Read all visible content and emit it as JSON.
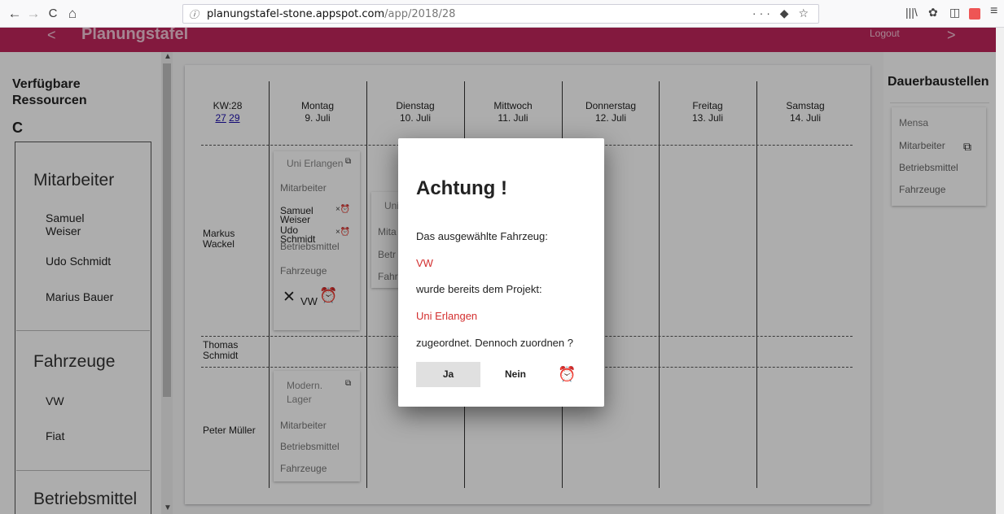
{
  "browser": {
    "back": "←",
    "forward": "→",
    "reload": "C",
    "home": "⌂",
    "info_icon": "ⓘ",
    "url_host": "planungstafel-stone.appspot.com",
    "url_path": "/app/2018/28",
    "url_actions": "··· ◆ ☆",
    "library_icon": "|||\\",
    "menu_icon": "≡"
  },
  "header": {
    "title": "Planungstafel",
    "logout": "Logout",
    "back": "<",
    "forward": ">"
  },
  "left_sidebar": {
    "title": "Verfügbare Ressourcen",
    "refresh": "C",
    "sections": {
      "mitarbeiter": {
        "title": "Mitarbeiter",
        "items": [
          "Samuel Weiser",
          "Udo Schmidt",
          "Marius Bauer"
        ]
      },
      "fahrzeuge": {
        "title": "Fahrzeuge",
        "items": [
          "VW",
          "Fiat"
        ]
      },
      "betriebsmittel": {
        "title": "Betriebsmittel"
      }
    }
  },
  "board": {
    "kw": {
      "label": "KW:28",
      "prev": "27",
      "next": "29"
    },
    "days": [
      {
        "name": "Montag",
        "date": "9. Juli"
      },
      {
        "name": "Dienstag",
        "date": "10. Juli"
      },
      {
        "name": "Mittwoch",
        "date": "11. Juli"
      },
      {
        "name": "Donnerstag",
        "date": "12. Juli"
      },
      {
        "name": "Freitag",
        "date": "13. Juli"
      },
      {
        "name": "Samstag",
        "date": "14. Juli"
      }
    ],
    "rows": [
      "Markus Wackel",
      "Thomas Schmidt",
      "Peter Müller"
    ],
    "card1": {
      "project": "Uni Erlangen",
      "mitarbeiter": "Mitarbeiter",
      "persons": [
        "Samuel Weiser",
        "Udo Schmidt"
      ],
      "person_actions": "×⏰",
      "betriebsmittel": "Betriebsmittel",
      "fahrzeuge": "Fahrzeuge",
      "vehicle": "VW",
      "remove": "✕",
      "alarm": "⏰"
    },
    "card2": {
      "project": "Uni",
      "mitarbeiter": "Mita",
      "betriebsmittel": "Betr",
      "fahrzeuge": "Fahr"
    },
    "card3": {
      "project": "Modern. Lager",
      "mitarbeiter": "Mitarbeiter",
      "betriebsmittel": "Betriebsmittel",
      "fahrzeuge": "Fahrzeuge"
    },
    "ext_icon": "⧉"
  },
  "right_sidebar": {
    "title": "Dauerbaustellen",
    "project": "Mensa",
    "items": [
      "Mitarbeiter",
      "Betriebsmittel",
      "Fahrzeuge"
    ],
    "ext_icon": "⧉"
  },
  "dialog": {
    "title": "Achtung !",
    "line1": "Das ausgewählte Fahrzeug:",
    "vehicle": "VW",
    "line2": "wurde bereits dem Projekt:",
    "project": "Uni Erlangen",
    "line3": "zugeordnet. Dennoch zuordnen ?",
    "yes": "Ja",
    "no": "Nein",
    "alarm": "⏰"
  }
}
